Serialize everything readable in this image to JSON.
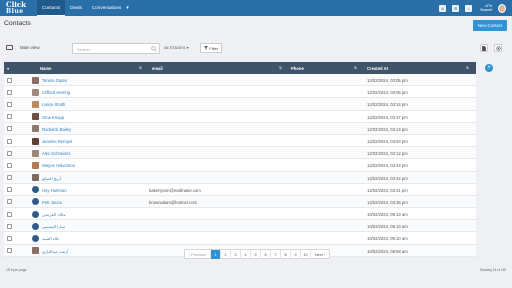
{
  "app": {
    "logo_top": "Click",
    "logo_sub": "Blue",
    "nav": [
      {
        "label": "Contacts",
        "active": true
      },
      {
        "label": "Deals",
        "active": false
      },
      {
        "label": "Conversations",
        "active": false
      }
    ],
    "nav_more": "▾",
    "user": {
      "status": "•4°N",
      "name": "Shareef"
    }
  },
  "page": {
    "title": "Contacts",
    "new_contact_label": "New Contact"
  },
  "toolbar": {
    "view_label": "Main view",
    "search_placeholder": "Search",
    "status_label": "All STAGES ▾",
    "filter_label": "Filter"
  },
  "table": {
    "headers": {
      "name": "Name",
      "email": "email",
      "phone": "Phone",
      "created": "Created At"
    },
    "rows": [
      {
        "name": "Teresa Gates",
        "email": "",
        "created": "12/02/2024, 03:05 pm",
        "avatar": "#8d6e63"
      },
      {
        "name": "Clifford Herring",
        "email": "",
        "created": "12/02/2024, 03:05 pm",
        "avatar": "#a1887f"
      },
      {
        "name": "Lance Smith",
        "email": "",
        "created": "12/02/2024, 03:14 pm",
        "avatar": "#c08a5a"
      },
      {
        "name": "Gina Knapp",
        "email": "",
        "created": "12/02/2024, 03:37 pm",
        "avatar": "#6d4c41"
      },
      {
        "name": "Roderick Bailey",
        "email": "",
        "created": "12/02/2024, 03:14 pm",
        "avatar": "#8e7a6b"
      },
      {
        "name": "Jeanine Rempel",
        "email": "",
        "created": "12/02/2024, 03:53 pm",
        "avatar": "#5d4037"
      },
      {
        "name": "Alex Schneider",
        "email": "",
        "created": "12/02/2024, 03:12 pm",
        "avatar": "#9e8778"
      },
      {
        "name": "Wayne Halvorson",
        "email": "",
        "created": "12/02/2024, 03:43 pm",
        "avatar": "#b07b56"
      },
      {
        "name": "أريج الصائغ",
        "email": "",
        "created": "12/02/2024, 03:42 pm",
        "avatar": "#7b6a5f"
      },
      {
        "name": "Hoy Hartman",
        "email": "bakertyson@mailinator.com",
        "created": "12/02/2024, 03:41 pm",
        "avatar": "#2f5b8a",
        "round": true
      },
      {
        "name": "Petr Jouce",
        "email": "brownadam@hotmer.com",
        "created": "12/02/2024, 03:36 pm",
        "avatar": "#2f5b8a",
        "round": true
      },
      {
        "name": "مالك الفريحي",
        "email": "",
        "created": "10/02/2024, 09:13 am",
        "avatar": "#2f5b8a",
        "round": true
      },
      {
        "name": "سارا البسيس",
        "email": "",
        "created": "10/02/2024, 09:13 am",
        "avatar": "#2f5b8a",
        "round": true
      },
      {
        "name": "علاء السيد",
        "email": "",
        "created": "10/02/2024, 09:10 am",
        "avatar": "#2f5b8a",
        "round": true
      },
      {
        "name": "أرشد عبدالباري",
        "email": "",
        "created": "10/02/2024, 08:58 am",
        "avatar": "#8d6e63"
      }
    ]
  },
  "footer": {
    "per_page": "15 ▾ per page",
    "showing": "Showing 15 of 145"
  },
  "pagination": {
    "prev": "‹ Previous",
    "pages": [
      "1",
      "2",
      "3",
      "4",
      "5",
      "6",
      "7",
      "8",
      "9",
      "10"
    ],
    "active_page": "1",
    "next": "Next ›"
  },
  "colors": {
    "topbar": "#2b6fa8",
    "accent": "#2f93d6",
    "table_header": "#3f5469",
    "link": "#2f7fc1"
  }
}
